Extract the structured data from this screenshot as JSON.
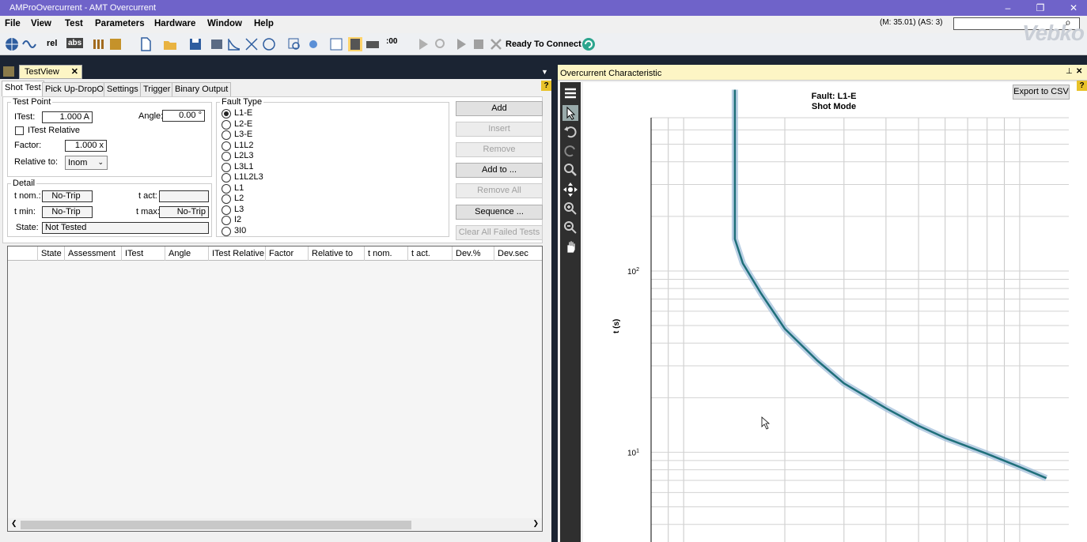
{
  "window": {
    "title": "AMProOvercurrent - AMT Overcurrent",
    "status_m": "(M: 35.01) (AS: 3)",
    "search_value": ""
  },
  "menu": [
    "File",
    "View",
    "Test",
    "Parameters",
    "Hardware",
    "Window",
    "Help"
  ],
  "toolbar": {
    "rel": "rel",
    "abs": "abs",
    "ready": "Ready To Connect"
  },
  "testview": {
    "tab_title": "TestView",
    "tabs": [
      "Shot Test",
      "Pick Up-DropOff",
      "Settings",
      "Trigger",
      "Binary Output"
    ],
    "test_point": {
      "group_label": "Test Point",
      "itest_label": "ITest:",
      "itest_value": "1.000 A",
      "angle_label": "Angle:",
      "angle_value": "0.00 °",
      "itest_relative_label": "ITest Relative",
      "factor_label": "Factor:",
      "factor_value": "1.000 x",
      "relative_to_label": "Relative to:",
      "relative_to_value": "Inom"
    },
    "detail": {
      "group_label": "Detail",
      "tnom_label": "t nom.:",
      "tnom_value": "No-Trip",
      "tact_label": "t act:",
      "tact_value": "",
      "tmin_label": "t min:",
      "tmin_value": "No-Trip",
      "tmax_label": "t max:",
      "tmax_value": "No-Trip",
      "state_label": "State:",
      "state_value": "Not Tested"
    },
    "fault_type": {
      "group_label": "Fault Type",
      "options": [
        "L1-E",
        "L2-E",
        "L3-E",
        "L1L2",
        "L2L3",
        "L3L1",
        "L1L2L3",
        "L1",
        "L2",
        "L3",
        "I2",
        "3I0"
      ],
      "selected": "L1-E"
    },
    "buttons": {
      "add": "Add",
      "insert": "Insert",
      "remove": "Remove",
      "add_to": "Add to ...",
      "remove_all": "Remove All",
      "sequence": "Sequence ...",
      "clear_failed": "Clear All Failed Tests"
    },
    "grid_columns": [
      "",
      "State",
      "Assessment",
      "ITest",
      "Angle",
      "ITest Relative",
      "Factor",
      "Relative to",
      "t nom.",
      "t act.",
      "Dev.%",
      "Dev.sec"
    ]
  },
  "overcurrent": {
    "panel_title": "Overcurrent Characteristic",
    "export_button": "Export to CSV",
    "help_icon": "?"
  },
  "chart_data": {
    "type": "line",
    "title": "Fault: L1-E",
    "subtitle": "Shot Mode",
    "ylabel": "t (s)",
    "xlabel": "",
    "yscale": "log",
    "xscale": "log",
    "ytick_labels": [
      "10^1",
      "10^2"
    ],
    "grid": true,
    "legend": "none",
    "series": [
      {
        "color": "#1f6f7a",
        "points": [
          [
            1.42,
            1000
          ],
          [
            1.42,
            150
          ],
          [
            1.5,
            110
          ],
          [
            1.7,
            75
          ],
          [
            2.0,
            48
          ],
          [
            2.5,
            32
          ],
          [
            3.0,
            24
          ],
          [
            4.0,
            17.5
          ],
          [
            5.0,
            14
          ],
          [
            6.0,
            12
          ],
          [
            8.0,
            9.8
          ],
          [
            10.0,
            8.3
          ],
          [
            12.0,
            7.2
          ]
        ]
      }
    ]
  }
}
